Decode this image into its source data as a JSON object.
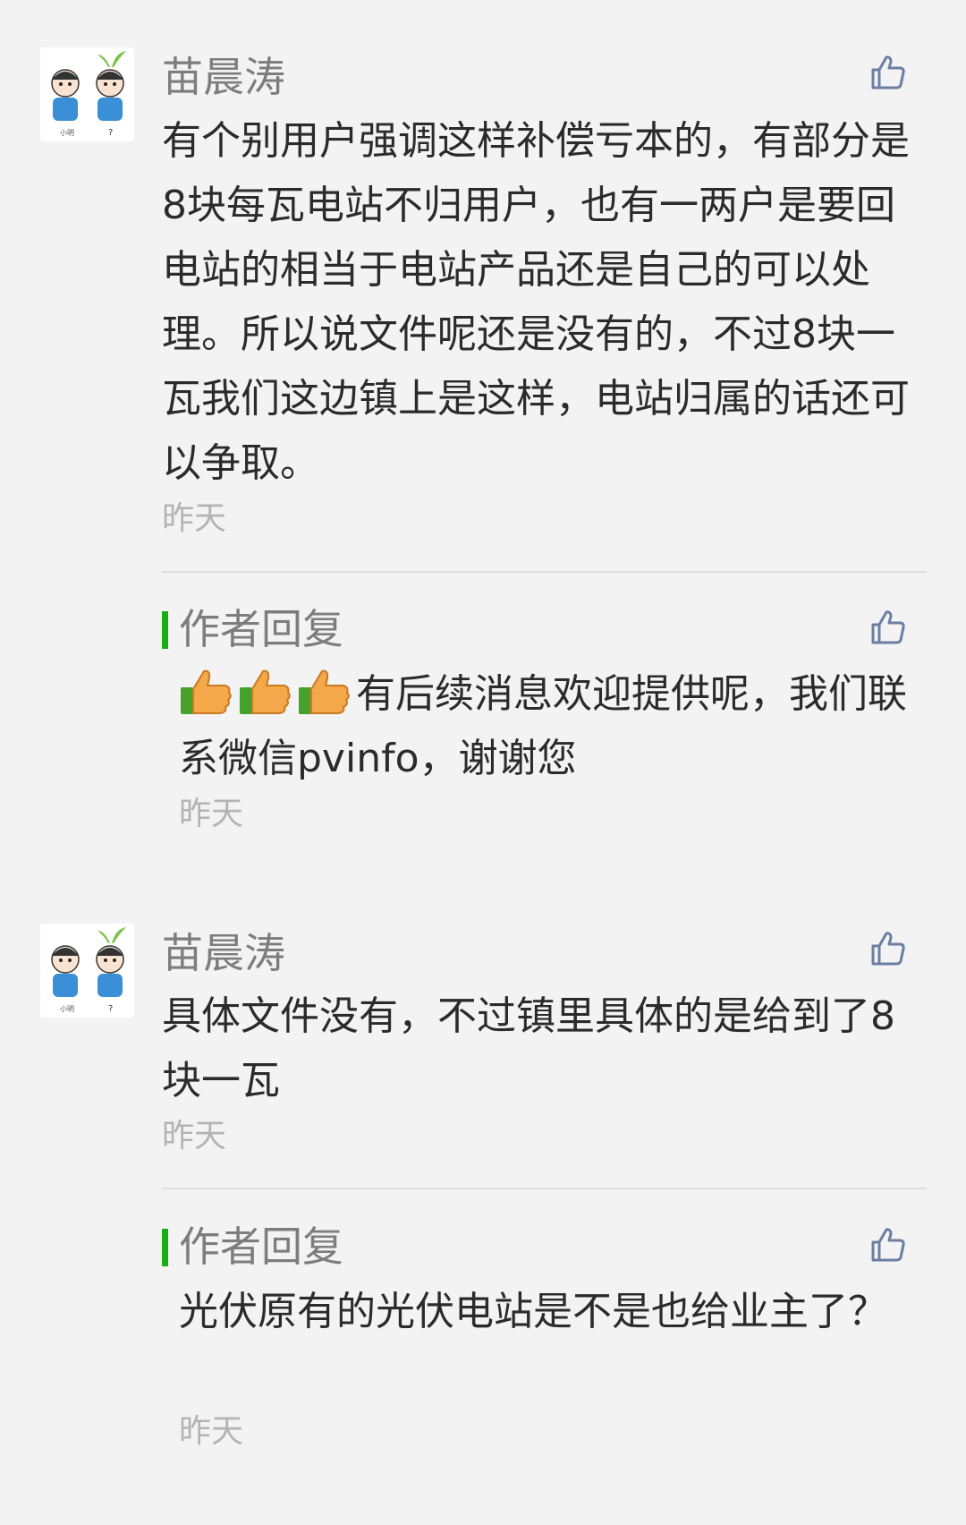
{
  "comments": [
    {
      "username": "苗晨涛",
      "text": "有个别用户强调这样补偿亏本的，有部分是8块每瓦电站不归用户，也有一两户是要回电站的相当于电站产品还是自己的可以处理。所以说文件呢还是没有的，不过8块一瓦我们这边镇上是这样，电站归属的话还可以争取。",
      "time": "昨天",
      "reply": {
        "label": "作者回复",
        "emoji": [
          "thumbs-up-emoji",
          "thumbs-up-emoji",
          "thumbs-up-emoji"
        ],
        "text": "有后续消息欢迎提供呢，我们联系微信pvinfo，谢谢您",
        "time": "昨天"
      }
    },
    {
      "username": "苗晨涛",
      "text": "具体文件没有，不过镇里具体的是给到了8块一瓦",
      "time": "昨天",
      "reply": {
        "label": "作者回复",
        "text": "光伏原有的光伏电站是不是也给业主了？",
        "time": "昨天"
      }
    }
  ],
  "colors": {
    "background": "#f3f3f3",
    "accent_green": "#1aad19",
    "like_icon": "#6b7fa3",
    "text_primary": "#2b2b2b",
    "text_secondary": "#7d7d7d",
    "text_muted": "#b4b4b4"
  }
}
